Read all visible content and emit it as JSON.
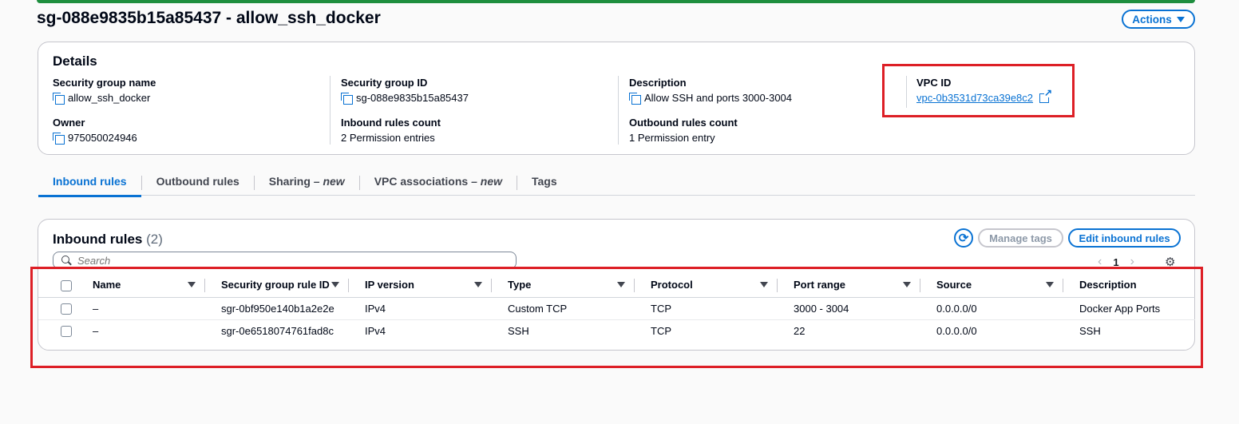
{
  "page": {
    "title": "sg-088e9835b15a85437 - allow_ssh_docker",
    "actions_label": "Actions"
  },
  "details": {
    "title": "Details",
    "fields": {
      "sg_name": {
        "label": "Security group name",
        "value": "allow_ssh_docker"
      },
      "sg_id": {
        "label": "Security group ID",
        "value": "sg-088e9835b15a85437"
      },
      "description": {
        "label": "Description",
        "value": "Allow SSH and ports 3000-3004"
      },
      "vpc_id": {
        "label": "VPC ID",
        "value": "vpc-0b3531d73ca39e8c2"
      },
      "owner": {
        "label": "Owner",
        "value": "975050024946"
      },
      "inbound_count": {
        "label": "Inbound rules count",
        "value": "2 Permission entries"
      },
      "outbound_count": {
        "label": "Outbound rules count",
        "value": "1 Permission entry"
      }
    }
  },
  "tabs": [
    {
      "label": "Inbound rules"
    },
    {
      "label": "Outbound rules"
    },
    {
      "label": "Sharing",
      "suffix": "– new"
    },
    {
      "label": "VPC associations",
      "suffix": "– new"
    },
    {
      "label": "Tags"
    }
  ],
  "inbound": {
    "title": "Inbound rules",
    "count": "(2)",
    "manage_tags_label": "Manage tags",
    "edit_label": "Edit inbound rules",
    "search_placeholder": "Search",
    "page_number": "1",
    "columns": [
      "Name",
      "Security group rule ID",
      "IP version",
      "Type",
      "Protocol",
      "Port range",
      "Source",
      "Description"
    ],
    "rows": [
      [
        "–",
        "sgr-0bf950e140b1a2e2e",
        "IPv4",
        "Custom TCP",
        "TCP",
        "3000 - 3004",
        "0.0.0.0/0",
        "Docker App Ports"
      ],
      [
        "–",
        "sgr-0e6518074761fad8c",
        "IPv4",
        "SSH",
        "TCP",
        "22",
        "0.0.0.0/0",
        "SSH"
      ]
    ]
  },
  "colors": {
    "accent": "#0972d3",
    "highlight": "#dd1f26",
    "success_bar": "#1e8e3e"
  }
}
